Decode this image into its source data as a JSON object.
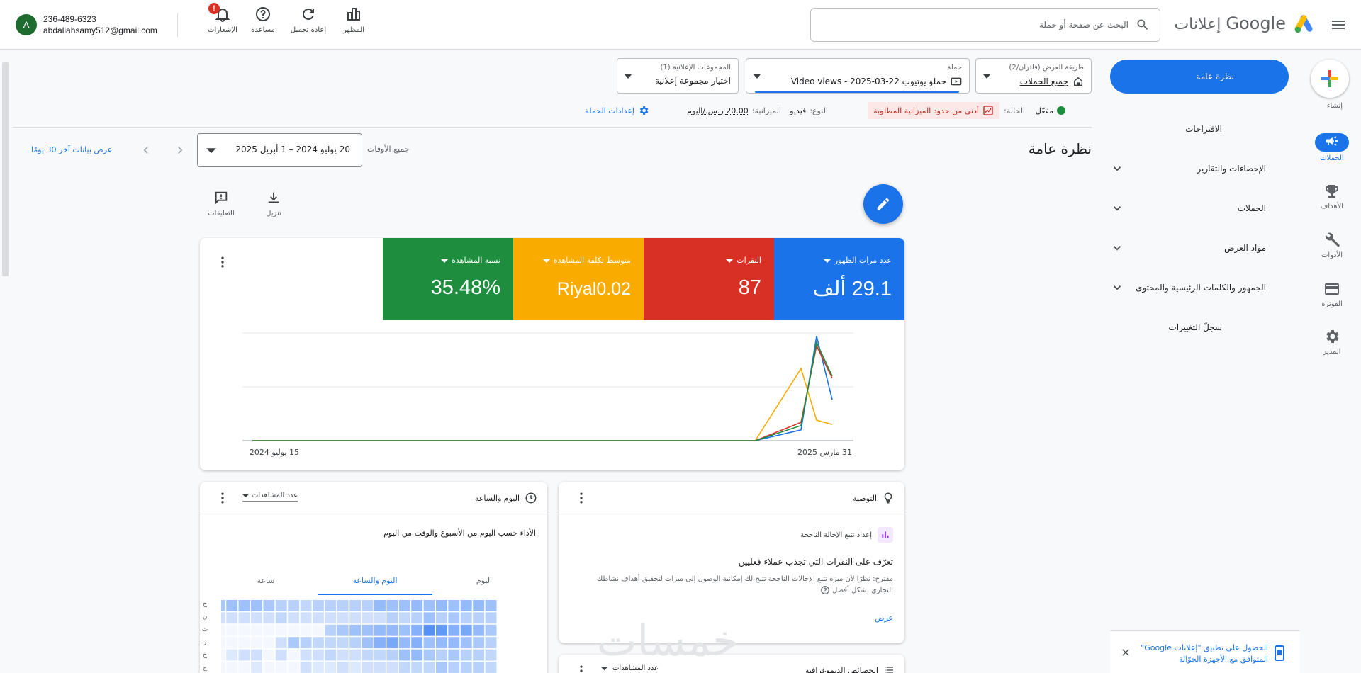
{
  "header": {
    "logo_google": "Google",
    "logo_product": "إعلانات",
    "search_placeholder": "البحث عن صفحة أو حملة",
    "tools": [
      {
        "label": "المظهر"
      },
      {
        "label": "إعادة تحميل"
      },
      {
        "label": "مساعدة"
      },
      {
        "label": "الإشعارات"
      }
    ],
    "notification_badge": "!",
    "account": {
      "initial": "A",
      "id": "236-489-6323",
      "email": "abdallahsamy512@gmail.com"
    }
  },
  "rail": {
    "create": "إنشاء",
    "items": [
      {
        "label": "الحملات",
        "icon": "megaphone-icon"
      },
      {
        "label": "الأهداف",
        "icon": "trophy-icon"
      },
      {
        "label": "الأدوات",
        "icon": "tools-icon"
      },
      {
        "label": "الفوترة",
        "icon": "credit-card-icon"
      },
      {
        "label": "المدير",
        "icon": "gear-icon"
      }
    ]
  },
  "nav": {
    "overview": "نظرة عامة",
    "items": [
      {
        "label": "الاقتراحات"
      },
      {
        "label": "الإحصاءات والتقارير"
      },
      {
        "label": "الحملات"
      },
      {
        "label": "مواد العرض"
      },
      {
        "label": "الجمهور والكلمات الرئيسية والمحتوى"
      },
      {
        "label": "سجلّ التغييرات"
      }
    ],
    "promo": "الحصول على تطبيق \"إعلانات Google\" المتوافق مع الأجهزة الجوّالة"
  },
  "context": {
    "view": {
      "label": "طريقة العرض (فلتران/2)",
      "value": "جميع الحملات"
    },
    "campaign": {
      "label": "حملة",
      "value": "Video views - 2025-03-22 حملو يوتيوب"
    },
    "adgroup": {
      "label": "المجموعات الإعلانية (1)",
      "value": "اختيار مجموعة إعلانية"
    }
  },
  "status": {
    "state_label": "الحالة:",
    "state_value": "مفعّل",
    "warning": "أدنى من حدود الميزانية المطلوبة",
    "type_label": "النوع:",
    "type_value": "فيديو",
    "budget_label": "الميزانية:",
    "budget_value": "20.00 ر.س./اليوم",
    "settings": "إعدادات الحملة"
  },
  "page": {
    "title": "نظرة عامة",
    "date_caption": "جميع الأوقات",
    "date_range": "20 يوليو 2024 – 1 أبريل 2025",
    "last30": "عرض بيانات آخر 30 يومًا"
  },
  "card_tools": {
    "download": "تنزيل",
    "comments": "التعليقات"
  },
  "metrics": [
    {
      "label": "عدد مرات الظهور",
      "value": "29.1 ألف",
      "color": "#1a73e8"
    },
    {
      "label": "النقرات",
      "value": "87",
      "color": "#d93025"
    },
    {
      "label": "متوسط تكلفة المشاهدة",
      "value": "Riyal0.02",
      "color": "#f9ab00"
    },
    {
      "label": "نسبة المشاهدة",
      "value": "35.48%",
      "color": "#1e8e3e"
    }
  ],
  "chart_data": {
    "type": "line",
    "x_labels": [
      "15 يوليو 2024",
      "31 مارس 2025"
    ],
    "series": [
      {
        "color": "#1a73e8",
        "values": [
          0,
          0,
          0,
          0,
          0,
          0,
          0,
          0,
          0,
          0,
          0,
          0,
          0.1,
          0.97,
          0.38
        ]
      },
      {
        "color": "#d93025",
        "values": [
          0,
          0,
          0,
          0,
          0,
          0,
          0,
          0,
          0,
          0,
          0,
          0,
          0.17,
          0.88,
          0.58
        ]
      },
      {
        "color": "#f9ab00",
        "values": [
          0,
          0,
          0,
          0,
          0,
          0,
          0,
          0,
          0,
          0,
          0,
          0,
          0.67,
          0.19,
          0.15
        ]
      },
      {
        "color": "#1e8e3e",
        "values": [
          0,
          0,
          0,
          0,
          0,
          0,
          0,
          0,
          0,
          0,
          0,
          0,
          0.14,
          0.91,
          0.6
        ]
      }
    ]
  },
  "reco": {
    "title": "التوصية",
    "sub": "إعداد تتبع الإحالة الناجحة",
    "headline": "تعرّف على النقرات التي تجذب عملاء فعليين",
    "body": "مقترح: نظرًا لأن ميزة تتبع الإحالات الناجحة تتيح لك إمكانية الوصول إلى ميزات لتحقيق أهداف نشاطك التجاري بشكل أفضل",
    "view": "عرض"
  },
  "dayhour": {
    "title": "اليوم والساعة",
    "metric": "عدد المشاهدات",
    "caption": "الأداء حسب اليوم من الأسبوع والوقت من اليوم",
    "tabs": [
      "اليوم",
      "اليوم والساعة",
      "ساعة"
    ],
    "row_labels": [
      "ح",
      "ن",
      "ث",
      "ر",
      "خ",
      "ج"
    ],
    "heat": [
      [
        0.3,
        0.35,
        0.35,
        0.3,
        0.35,
        0.3,
        0.35,
        0.3,
        0.3,
        0.35,
        0.2,
        0.2,
        0.2,
        0.2,
        0.2,
        0.15,
        0.2,
        0.2,
        0.25,
        0.3,
        0.3,
        0.3,
        0.25,
        0.2
      ],
      [
        0.2,
        0.2,
        0.2,
        0.25,
        0.2,
        0.3,
        0.2,
        0.15,
        0.2,
        0.1,
        0.1,
        0.1,
        0.1,
        0.1,
        0.1,
        0.1,
        0.1,
        0.15,
        0.1,
        0.1,
        0.1,
        0.1,
        0.1,
        0.05
      ],
      [
        0.25,
        0.35,
        0.45,
        0.4,
        0.55,
        0.6,
        0.4,
        0.3,
        0.35,
        0.35,
        0.3,
        0.3,
        0.25,
        0.2,
        0,
        0,
        0,
        0,
        0,
        0,
        0,
        0,
        0,
        0
      ],
      [
        0.2,
        0.25,
        0.3,
        0.35,
        0.35,
        0.3,
        0.4,
        0.35,
        0.45,
        0.4,
        0.3,
        0.2,
        0.15,
        0.15,
        0.15,
        0.2,
        0.25,
        0.1,
        0,
        0,
        0,
        0,
        0,
        0
      ],
      [
        0.15,
        0.2,
        0.2,
        0.25,
        0.2,
        0.25,
        0.35,
        0.3,
        0.2,
        0.15,
        0.15,
        0.1,
        0.1,
        0.15,
        0.1,
        0.1,
        0,
        0.1,
        0,
        0.1,
        0.1,
        0.05,
        0,
        0
      ],
      [
        0.15,
        0.2,
        0.2,
        0.2,
        0.25,
        0.15,
        0.15,
        0.15,
        0.1,
        0.1,
        0.1,
        0.05,
        0.1,
        0.05,
        0.05,
        0.1,
        0,
        0,
        0,
        0.05,
        0,
        0,
        0,
        0
      ]
    ]
  },
  "bottom_next": {
    "title": "الخصائص الديموغرافية",
    "metric": "عدد المشاهدات"
  },
  "watermark": "خمسات"
}
